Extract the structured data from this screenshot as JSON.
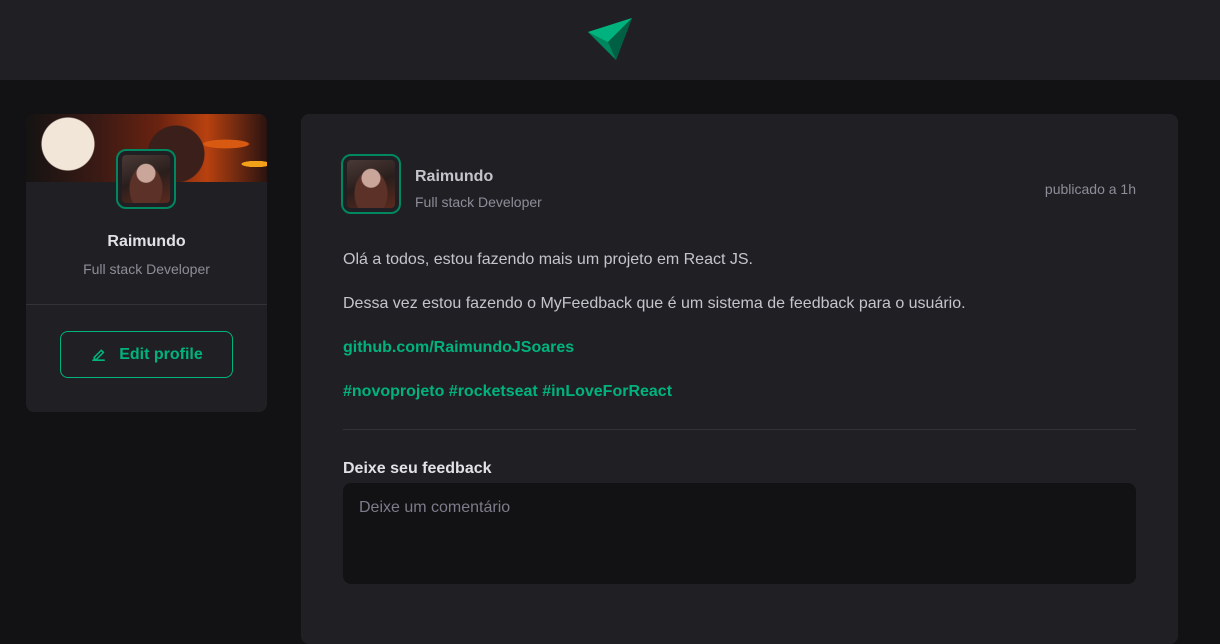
{
  "header": {
    "logo_icon": "paper-plane-logo-icon"
  },
  "sidebar": {
    "name": "Raimundo",
    "role": "Full stack Developer",
    "edit_button": {
      "label": "Edit profile",
      "icon": "pencil-icon"
    }
  },
  "post": {
    "author": {
      "name": "Raimundo",
      "role": "Full stack Developer"
    },
    "published": "publicado a 1h",
    "content": {
      "paragraph_1": "Olá a todos, estou fazendo mais um projeto em React JS.",
      "paragraph_2": "Dessa vez estou fazendo o MyFeedback que é um sistema de feedback para o usuário.",
      "link": "github.com/RaimundoJSoares",
      "hashtags": [
        "#novoprojeto",
        "#rocketseat",
        "#inLoveForReact"
      ]
    },
    "feedback": {
      "title": "Deixe seu feedback",
      "placeholder": "Deixe um comentário"
    }
  },
  "colors": {
    "accent": "#00b37e",
    "background": "#121214",
    "surface": "#202024",
    "border": "#323238"
  }
}
